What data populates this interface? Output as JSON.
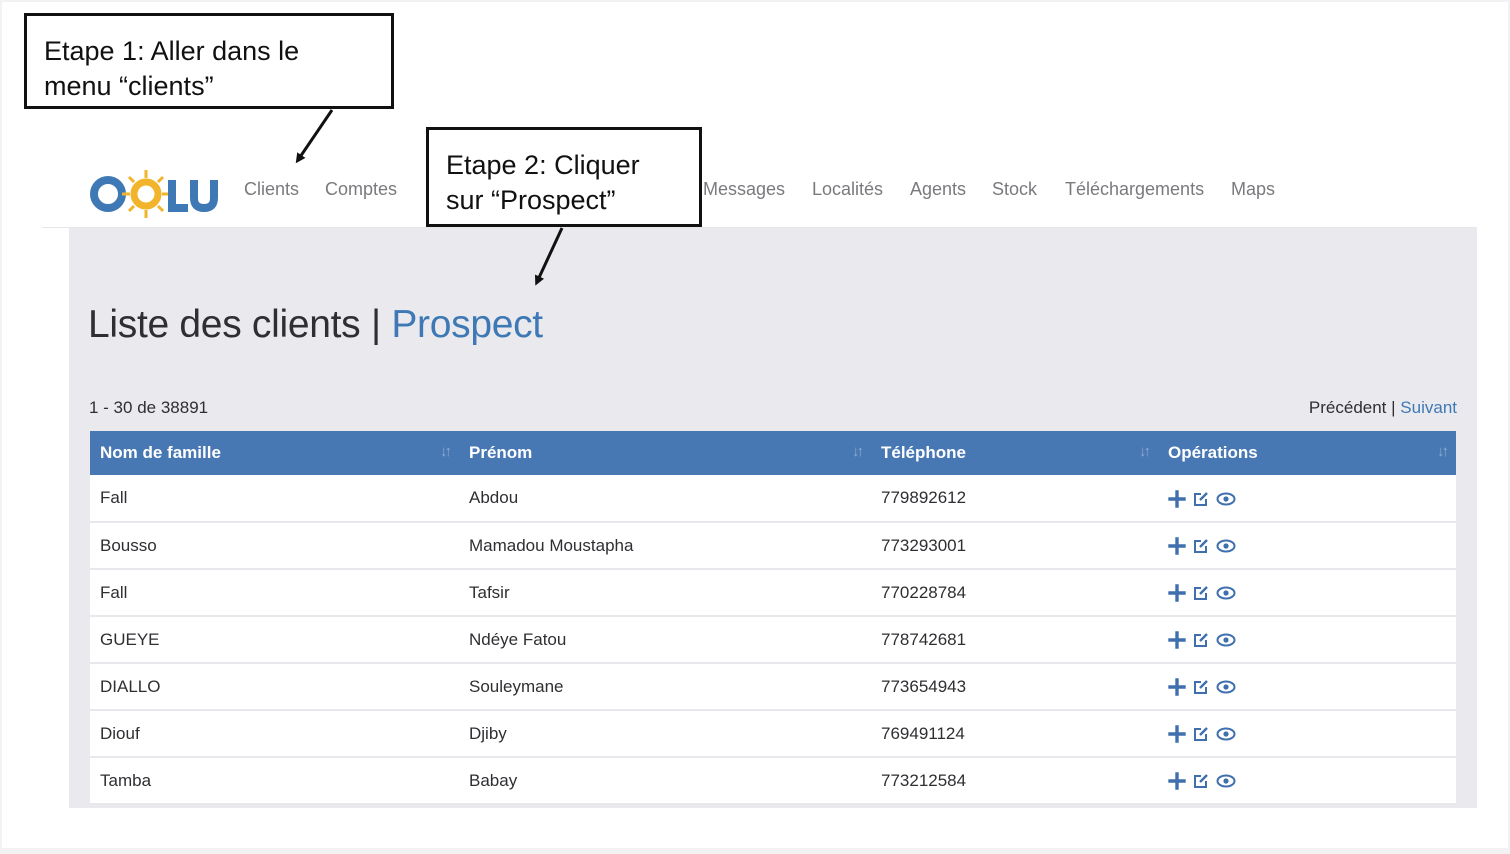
{
  "app": {
    "logo_text": "OOLU",
    "colors": {
      "logo_blue": "#3f79b5",
      "logo_sun": "#f2b42a",
      "accent": "#4878b3"
    }
  },
  "nav": {
    "items": [
      "Clients",
      "Comptes",
      "Messages",
      "Localités",
      "Agents",
      "Stock",
      "Téléchargements",
      "Maps"
    ]
  },
  "page": {
    "title": "Liste des clients",
    "separator": "|",
    "active_link": "Prospect"
  },
  "pagination": {
    "range_text": "1 - 30 de 38891",
    "prev_label": "Précédent",
    "sep": "|",
    "next_label": "Suivant"
  },
  "table": {
    "columns": [
      "Nom de famille",
      "Prénom",
      "Téléphone",
      "Opérations"
    ],
    "sort_icon": "sort-icon",
    "op_icons": [
      "plus-icon",
      "edit-icon",
      "eye-icon"
    ],
    "rows": [
      [
        "Fall",
        "Abdou",
        "779892612"
      ],
      [
        "Bousso",
        "Mamadou Moustapha",
        "773293001"
      ],
      [
        "Fall",
        "Tafsir",
        "770228784"
      ],
      [
        "GUEYE",
        "Ndéye Fatou",
        "778742681"
      ],
      [
        "DIALLO",
        "Souleymane",
        "773654943"
      ],
      [
        "Diouf",
        "Djiby",
        "769491124"
      ],
      [
        "Tamba",
        "Babay",
        "773212584"
      ]
    ]
  },
  "annotations": {
    "step1": {
      "line1": "Etape 1: Aller dans le",
      "line2": "menu “clients”"
    },
    "step2": {
      "line1": "Etape 2: Cliquer",
      "line2": "sur “Prospect”"
    }
  }
}
